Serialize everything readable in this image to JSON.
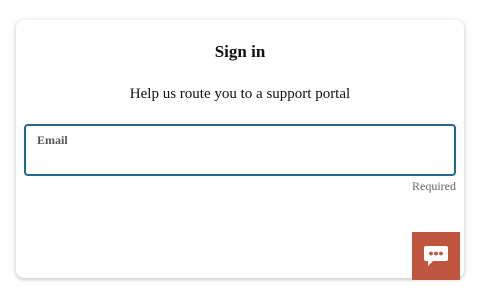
{
  "signin": {
    "title": "Sign in",
    "subtitle": "Help us route you to a support portal"
  },
  "email": {
    "label": "Email",
    "value": "",
    "placeholder": "",
    "hint": "Required"
  },
  "chat": {
    "icon": "chat-bubble-icon",
    "color": "#c0553f"
  },
  "colors": {
    "focus_border": "#1e6a8a",
    "card_bg": "#ffffff"
  }
}
